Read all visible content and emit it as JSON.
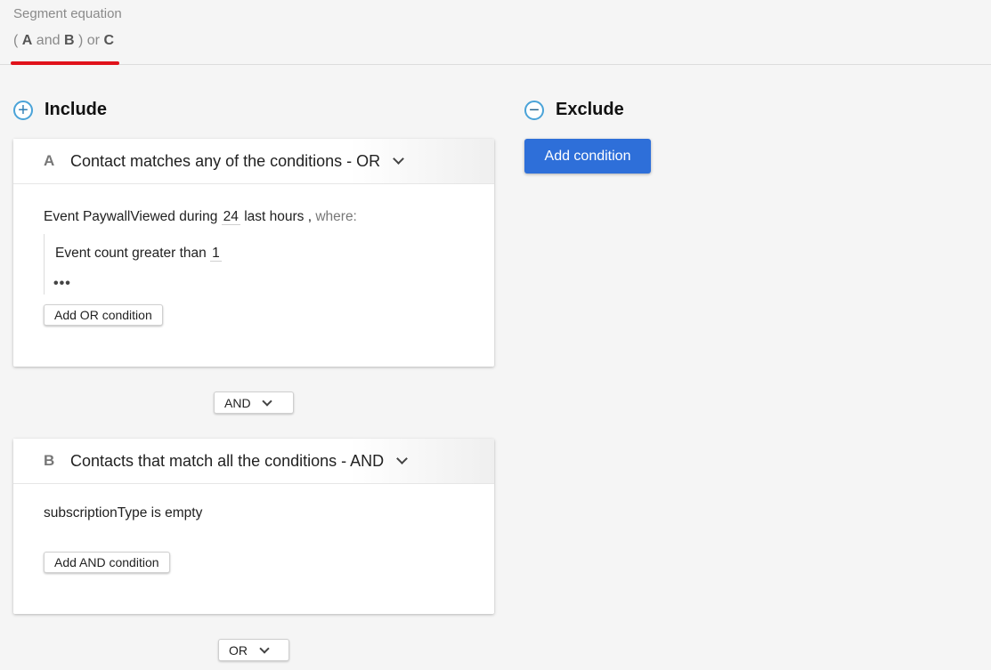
{
  "equation": {
    "label": "Segment equation",
    "open_paren": "(",
    "var_a": "A",
    "and_word": "and",
    "var_b": "B",
    "close_paren": ")",
    "or_word": "or",
    "var_c": "C",
    "underline_color": "#e0121a"
  },
  "include": {
    "icon": "plus-circle-icon",
    "title": "Include"
  },
  "exclude": {
    "icon": "minus-circle-icon",
    "title": "Exclude",
    "add_label": "Add condition",
    "add_color": "#2e6fd9"
  },
  "group_a": {
    "letter": "A",
    "title": "Contact matches any of the conditions - OR",
    "event_prefix": "Event",
    "event_name": "PaywallViewed",
    "during_word": "during",
    "during_value": "24",
    "period": "last hours",
    "comma": ",",
    "where_word": "where:",
    "sub_field": "Event count",
    "sub_operator": "greater than",
    "sub_value": "1",
    "more": "•••",
    "add_label": "Add OR condition"
  },
  "connector_1": {
    "label": "AND"
  },
  "group_b": {
    "letter": "B",
    "title": "Contacts that match all the conditions - AND",
    "field": "subscriptionType",
    "operator": "is empty",
    "add_label": "Add AND condition"
  },
  "connector_2": {
    "label": "OR"
  }
}
